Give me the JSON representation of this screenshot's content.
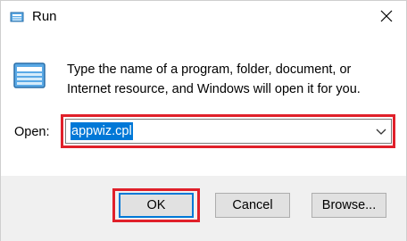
{
  "window": {
    "title": "Run",
    "close_icon": "close-icon"
  },
  "body": {
    "description": "Type the name of a program, folder, document, or Internet resource, and Windows will open it for you.",
    "open_label": "Open:",
    "open_value": "appwiz.cpl"
  },
  "buttons": {
    "ok": "OK",
    "cancel": "Cancel",
    "browse": "Browse..."
  },
  "colors": {
    "highlight": "#e0202a",
    "selection": "#0078d7",
    "footer": "#f0f0f0"
  }
}
